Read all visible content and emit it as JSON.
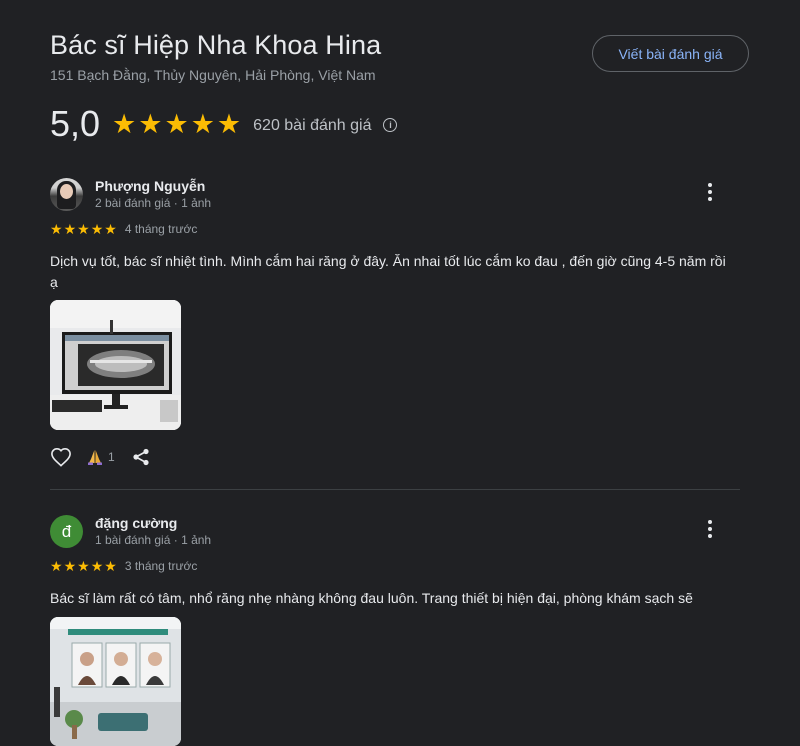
{
  "place": {
    "title": "Bác sĩ Hiệp Nha Khoa Hina",
    "address": "151 Bạch Đằng, Thủy Nguyên, Hải Phòng, Việt Nam",
    "write_review_label": "Viết bài đánh giá",
    "rating": "5,0",
    "stars": 5,
    "review_count": "620 bài đánh giá"
  },
  "reviews": [
    {
      "name": "Phượng Nguyễn",
      "meta": "2 bài đánh giá · 1 ảnh",
      "stars": 5,
      "time": "4 tháng trước",
      "text": "Dịch vụ tốt, bác sĩ nhiệt tình. Mình cắm hai răng ở đây. Ăn nhai tốt lúc cắm ko đau , đến giờ cũng 4-5 năm rồi ạ",
      "reaction_count": "1"
    },
    {
      "name": "đặng cường",
      "avatar_letter": "đ",
      "meta": "1 bài đánh giá · 1 ảnh",
      "stars": 5,
      "time": "3 tháng trước",
      "text": "Bác sĩ làm rất có tâm, nhổ răng nhẹ nhàng không đau luôn. Trang thiết bị hiện đại, phòng khám sạch sẽ"
    }
  ],
  "colors": {
    "background": "#202124",
    "star": "#fbbc04",
    "link": "#8ab4f8",
    "avatar_green": "#3f8c35"
  },
  "icons": [
    "star-icon",
    "info-icon",
    "more-vert-icon",
    "heart-outline-icon",
    "praying-hands-icon",
    "share-icon"
  ]
}
